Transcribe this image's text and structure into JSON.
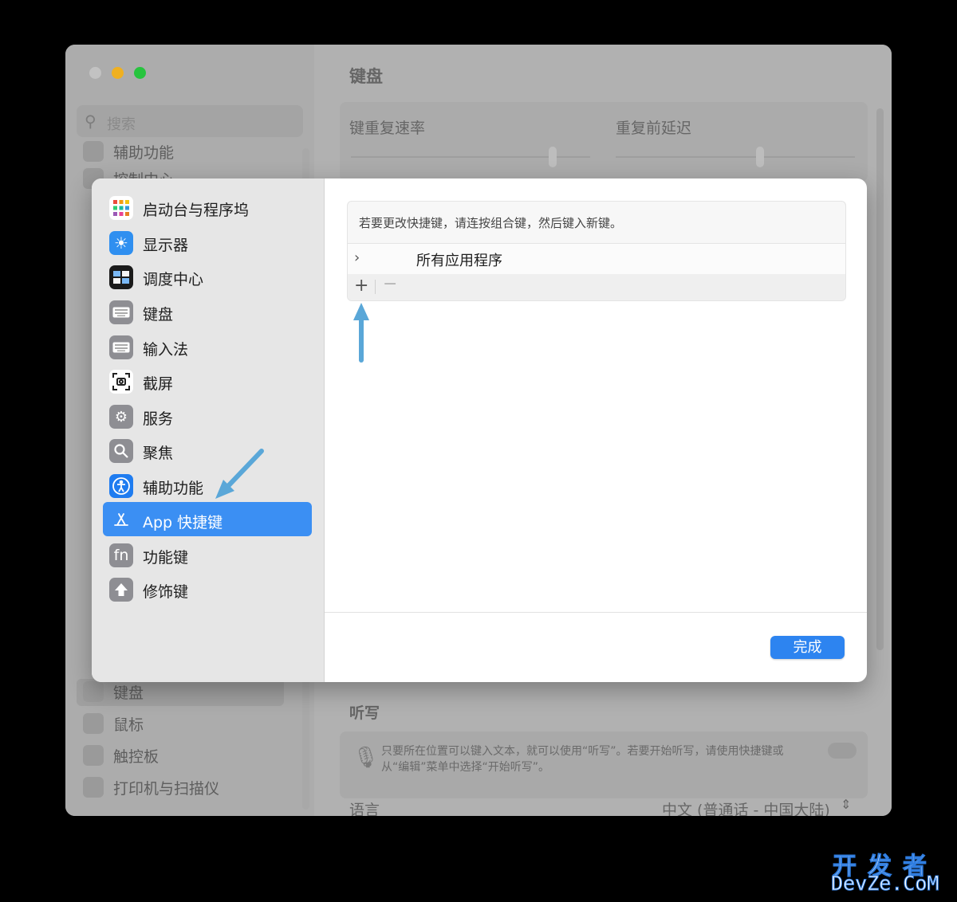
{
  "background_window": {
    "title": "键盘",
    "search_placeholder": "搜索",
    "repeat_rate_label": "键重复速率",
    "repeat_delay_label": "重复前延迟",
    "sidebar_partial": [
      "辅助功能",
      "控制中心"
    ],
    "sidebar_items": [
      "键盘",
      "鼠标",
      "触控板",
      "打印机与扫描仪"
    ],
    "selected_item": "键盘",
    "dictation_title": "听写",
    "dictation_desc_line1": "只要所在位置可以键入文本，就可以使用“听写”。若要开始听写，请使用快捷键或",
    "dictation_desc_line2": "从“编辑”菜单中选择“开始听写”。",
    "language_label": "语言",
    "language_value": "中文 (普通话 - 中国大陆)"
  },
  "sheet": {
    "nav": [
      {
        "label": "启动台与程序坞",
        "icon": "launchpad-icon"
      },
      {
        "label": "显示器",
        "icon": "display-icon"
      },
      {
        "label": "调度中心",
        "icon": "mission-control-icon"
      },
      {
        "label": "键盘",
        "icon": "keyboard-icon"
      },
      {
        "label": "输入法",
        "icon": "input-method-icon"
      },
      {
        "label": "截屏",
        "icon": "screenshot-icon"
      },
      {
        "label": "服务",
        "icon": "services-gear-icon"
      },
      {
        "label": "聚焦",
        "icon": "spotlight-icon"
      },
      {
        "label": "辅助功能",
        "icon": "accessibility-icon"
      },
      {
        "label": "App 快捷键",
        "icon": "app-store-icon"
      },
      {
        "label": "功能键",
        "icon": "fn-key-icon"
      },
      {
        "label": "修饰键",
        "icon": "modifier-arrow-icon"
      }
    ],
    "selected_nav": "App 快捷键",
    "hint_text": "若要更改快捷键，请连按组合键，然后键入新键。",
    "all_apps_label": "所有应用程序",
    "add_symbol": "+",
    "remove_symbol": "−",
    "done_label": "完成"
  },
  "watermark": {
    "line1": "开发者",
    "line2": "DevZe.CoM"
  },
  "colors": {
    "accent": "#3b8ff3",
    "annotation_arrow": "#5aa7d8"
  }
}
